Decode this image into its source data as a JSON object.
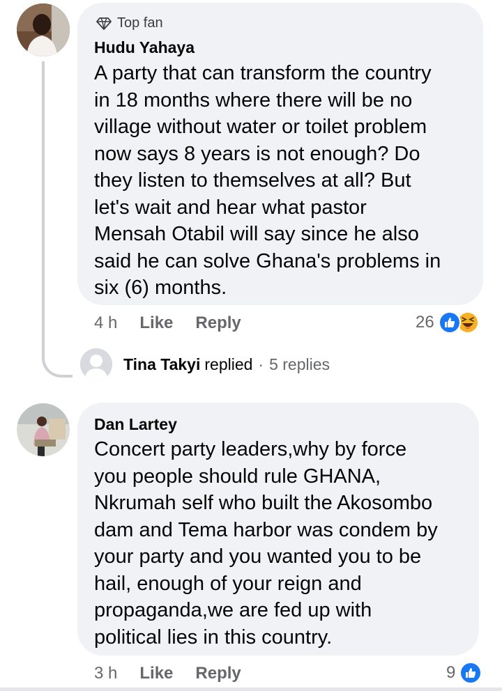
{
  "comments": [
    {
      "badge": "Top fan",
      "author": "Hudu Yahaya",
      "text": "A party that can transform the country\nin 18 months where there will be no\nvillage without water or toilet problem\nnow says 8 years is not enough? Do\nthey listen to themselves at all? But\nlet's wait and hear what pastor\nMensah Otabil will say since he also\nsaid he can solve Ghana's problems in\nsix (6) months.",
      "time": "4 h",
      "like_label": "Like",
      "reply_label": "Reply",
      "reaction_count": "26",
      "reaction_icons": [
        "like-icon",
        "haha-icon"
      ]
    },
    {
      "author": "Dan Lartey",
      "text": "Concert party leaders,why by force\nyou people should rule GHANA,\nNkrumah self who built the Akosombo\ndam and Tema harbor was condem by\nyour party and you wanted you to be\nhail, enough of your reign and\npropaganda,we are fed up with\npolitical lies in this country.",
      "time": "3 h",
      "like_label": "Like",
      "reply_label": "Reply",
      "reaction_count": "9",
      "reaction_icons": [
        "like-icon"
      ]
    }
  ],
  "reply_summary": {
    "name": "Tina Takyi",
    "verb": "replied",
    "separator": "·",
    "count": "5 replies"
  },
  "colors": {
    "bubble": "#f0f2f5",
    "secondary_text": "#65676b",
    "like_blue": "#1877f2",
    "haha_yellow": "#f7b125",
    "thread_line": "#ced0d4"
  }
}
